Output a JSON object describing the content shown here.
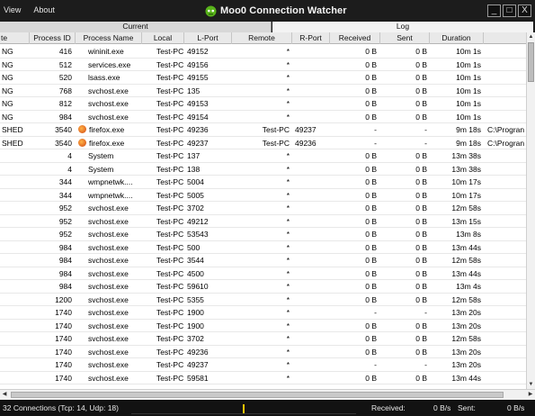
{
  "menu": {
    "view": "View",
    "about": "About"
  },
  "app": {
    "title": "Moo0 Connection Watcher"
  },
  "window_buttons": {
    "minimize": "_",
    "maximize": "□",
    "close": "X"
  },
  "tabs": {
    "current": "Current",
    "log": "Log"
  },
  "columns": [
    "te",
    "Process ID",
    "Process Name",
    "Local",
    "L-Port",
    "Remote",
    "R-Port",
    "Received",
    "Sent",
    "Duration"
  ],
  "rows": [
    {
      "state": "NG",
      "pid": "416",
      "name": "wininit.exe",
      "icon": "",
      "local": "Test-PC",
      "lport": "49152",
      "remote": "*",
      "rport": "",
      "recv": "0 B",
      "sent": "0 B",
      "dur": "10m 1s",
      "path": ""
    },
    {
      "state": "NG",
      "pid": "512",
      "name": "services.exe",
      "icon": "",
      "local": "Test-PC",
      "lport": "49156",
      "remote": "*",
      "rport": "",
      "recv": "0 B",
      "sent": "0 B",
      "dur": "10m 1s",
      "path": ""
    },
    {
      "state": "NG",
      "pid": "520",
      "name": "lsass.exe",
      "icon": "",
      "local": "Test-PC",
      "lport": "49155",
      "remote": "*",
      "rport": "",
      "recv": "0 B",
      "sent": "0 B",
      "dur": "10m 1s",
      "path": ""
    },
    {
      "state": "NG",
      "pid": "768",
      "name": "svchost.exe",
      "icon": "",
      "local": "Test-PC",
      "lport": "135",
      "remote": "*",
      "rport": "",
      "recv": "0 B",
      "sent": "0 B",
      "dur": "10m 1s",
      "path": ""
    },
    {
      "state": "NG",
      "pid": "812",
      "name": "svchost.exe",
      "icon": "",
      "local": "Test-PC",
      "lport": "49153",
      "remote": "*",
      "rport": "",
      "recv": "0 B",
      "sent": "0 B",
      "dur": "10m 1s",
      "path": ""
    },
    {
      "state": "NG",
      "pid": "984",
      "name": "svchost.exe",
      "icon": "",
      "local": "Test-PC",
      "lport": "49154",
      "remote": "*",
      "rport": "",
      "recv": "0 B",
      "sent": "0 B",
      "dur": "10m 1s",
      "path": ""
    },
    {
      "state": "SHED",
      "pid": "3540",
      "name": "firefox.exe",
      "icon": "firefox-icon",
      "local": "Test-PC",
      "lport": "49236",
      "remote": "Test-PC",
      "rport": "49237",
      "recv": "-",
      "sent": "-",
      "dur": "9m 18s",
      "path": "C:\\Progran"
    },
    {
      "state": "SHED",
      "pid": "3540",
      "name": "firefox.exe",
      "icon": "firefox-icon",
      "local": "Test-PC",
      "lport": "49237",
      "remote": "Test-PC",
      "rport": "49236",
      "recv": "-",
      "sent": "-",
      "dur": "9m 18s",
      "path": "C:\\Progran"
    },
    {
      "state": "",
      "pid": "4",
      "name": "System",
      "icon": "",
      "local": "Test-PC",
      "lport": "137",
      "remote": "*",
      "rport": "",
      "recv": "0 B",
      "sent": "0 B",
      "dur": "13m 38s",
      "path": ""
    },
    {
      "state": "",
      "pid": "4",
      "name": "System",
      "icon": "",
      "local": "Test-PC",
      "lport": "138",
      "remote": "*",
      "rport": "",
      "recv": "0 B",
      "sent": "0 B",
      "dur": "13m 38s",
      "path": ""
    },
    {
      "state": "",
      "pid": "344",
      "name": "wmpnetwk....",
      "icon": "",
      "local": "Test-PC",
      "lport": "5004",
      "remote": "*",
      "rport": "",
      "recv": "0 B",
      "sent": "0 B",
      "dur": "10m 17s",
      "path": ""
    },
    {
      "state": "",
      "pid": "344",
      "name": "wmpnetwk....",
      "icon": "",
      "local": "Test-PC",
      "lport": "5005",
      "remote": "*",
      "rport": "",
      "recv": "0 B",
      "sent": "0 B",
      "dur": "10m 17s",
      "path": ""
    },
    {
      "state": "",
      "pid": "952",
      "name": "svchost.exe",
      "icon": "",
      "local": "Test-PC",
      "lport": "3702",
      "remote": "*",
      "rport": "",
      "recv": "0 B",
      "sent": "0 B",
      "dur": "12m 58s",
      "path": ""
    },
    {
      "state": "",
      "pid": "952",
      "name": "svchost.exe",
      "icon": "",
      "local": "Test-PC",
      "lport": "49212",
      "remote": "*",
      "rport": "",
      "recv": "0 B",
      "sent": "0 B",
      "dur": "13m 15s",
      "path": ""
    },
    {
      "state": "",
      "pid": "952",
      "name": "svchost.exe",
      "icon": "",
      "local": "Test-PC",
      "lport": "53543",
      "remote": "*",
      "rport": "",
      "recv": "0 B",
      "sent": "0 B",
      "dur": "13m 8s",
      "path": ""
    },
    {
      "state": "",
      "pid": "984",
      "name": "svchost.exe",
      "icon": "",
      "local": "Test-PC",
      "lport": "500",
      "remote": "*",
      "rport": "",
      "recv": "0 B",
      "sent": "0 B",
      "dur": "13m 44s",
      "path": ""
    },
    {
      "state": "",
      "pid": "984",
      "name": "svchost.exe",
      "icon": "",
      "local": "Test-PC",
      "lport": "3544",
      "remote": "*",
      "rport": "",
      "recv": "0 B",
      "sent": "0 B",
      "dur": "12m 58s",
      "path": ""
    },
    {
      "state": "",
      "pid": "984",
      "name": "svchost.exe",
      "icon": "",
      "local": "Test-PC",
      "lport": "4500",
      "remote": "*",
      "rport": "",
      "recv": "0 B",
      "sent": "0 B",
      "dur": "13m 44s",
      "path": ""
    },
    {
      "state": "",
      "pid": "984",
      "name": "svchost.exe",
      "icon": "",
      "local": "Test-PC",
      "lport": "59610",
      "remote": "*",
      "rport": "",
      "recv": "0 B",
      "sent": "0 B",
      "dur": "13m 4s",
      "path": ""
    },
    {
      "state": "",
      "pid": "1200",
      "name": "svchost.exe",
      "icon": "",
      "local": "Test-PC",
      "lport": "5355",
      "remote": "*",
      "rport": "",
      "recv": "0 B",
      "sent": "0 B",
      "dur": "12m 58s",
      "path": ""
    },
    {
      "state": "",
      "pid": "1740",
      "name": "svchost.exe",
      "icon": "",
      "local": "Test-PC",
      "lport": "1900",
      "remote": "*",
      "rport": "",
      "recv": "-",
      "sent": "-",
      "dur": "13m 20s",
      "path": ""
    },
    {
      "state": "",
      "pid": "1740",
      "name": "svchost.exe",
      "icon": "",
      "local": "Test-PC",
      "lport": "1900",
      "remote": "*",
      "rport": "",
      "recv": "0 B",
      "sent": "0 B",
      "dur": "13m 20s",
      "path": ""
    },
    {
      "state": "",
      "pid": "1740",
      "name": "svchost.exe",
      "icon": "",
      "local": "Test-PC",
      "lport": "3702",
      "remote": "*",
      "rport": "",
      "recv": "0 B",
      "sent": "0 B",
      "dur": "12m 58s",
      "path": ""
    },
    {
      "state": "",
      "pid": "1740",
      "name": "svchost.exe",
      "icon": "",
      "local": "Test-PC",
      "lport": "49236",
      "remote": "*",
      "rport": "",
      "recv": "0 B",
      "sent": "0 B",
      "dur": "13m 20s",
      "path": ""
    },
    {
      "state": "",
      "pid": "1740",
      "name": "svchost.exe",
      "icon": "",
      "local": "Test-PC",
      "lport": "49237",
      "remote": "*",
      "rport": "",
      "recv": "-",
      "sent": "-",
      "dur": "13m 20s",
      "path": ""
    },
    {
      "state": "",
      "pid": "1740",
      "name": "svchost.exe",
      "icon": "",
      "local": "Test-PC",
      "lport": "59581",
      "remote": "*",
      "rport": "",
      "recv": "0 B",
      "sent": "0 B",
      "dur": "13m 44s",
      "path": ""
    }
  ],
  "status": {
    "connections": "32 Connections (Tcp: 14, Udp: 18)",
    "received_label": "Received:",
    "received_value": "0 B/s",
    "sent_label": "Sent:",
    "sent_value": "0 B/s"
  },
  "colors": {
    "titlebar": "#1c1c1c",
    "accent_graph": "#f5c400",
    "logo_green": "#58b31a"
  }
}
